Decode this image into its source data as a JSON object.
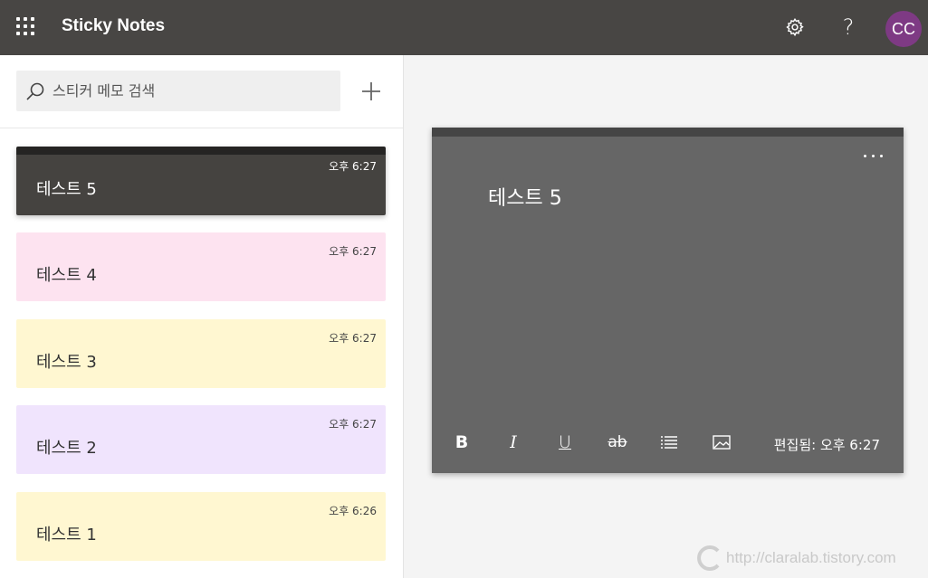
{
  "topbar": {
    "title": "Sticky Notes",
    "avatar_initials": "CC",
    "help_label": "?",
    "icons": [
      "waffle-icon",
      "gear-icon",
      "help-icon"
    ]
  },
  "search": {
    "placeholder": "스티커 메모 검색",
    "value": ""
  },
  "notes": [
    {
      "title": "테스트 5",
      "time": "오후 6:27",
      "color": "#454340",
      "selected": true
    },
    {
      "title": "테스트 4",
      "time": "오후 6:27",
      "color": "#fde3f0",
      "selected": false
    },
    {
      "title": "테스트 3",
      "time": "오후 6:27",
      "color": "#fff7d1",
      "selected": false
    },
    {
      "title": "테스트 2",
      "time": "오후 6:27",
      "color": "#f0e4fd",
      "selected": false
    },
    {
      "title": "테스트 1",
      "time": "오후 6:26",
      "color": "#fff7d1",
      "selected": false
    }
  ],
  "editor": {
    "text": "테스트 5",
    "edited_status": "편집됨: 오후 6:27",
    "toolbar": [
      "bold",
      "italic",
      "underline",
      "strikethrough",
      "bullets",
      "image"
    ],
    "bold_glyph": "B",
    "italic_glyph": "I",
    "underline_glyph": "U",
    "strike_glyph": "ab"
  },
  "watermark": {
    "text": "http://claralab.tistory.com"
  },
  "colors": {
    "topbar": "#484644",
    "avatar": "#7e3a84",
    "editor_bg": "#666666"
  }
}
